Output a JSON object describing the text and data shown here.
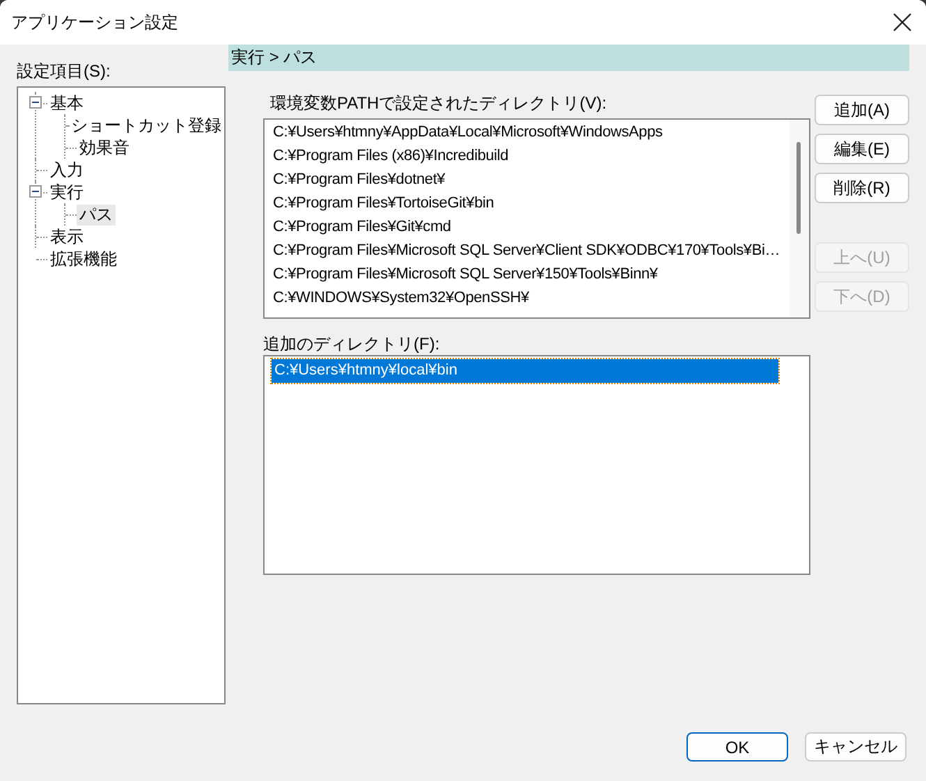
{
  "window": {
    "title": "アプリケーション設定"
  },
  "sidebar": {
    "label": "設定項目(S):",
    "items": [
      {
        "label": "基本",
        "expanded": true,
        "selected": false,
        "children": [
          {
            "label": "ショートカット登録",
            "selected": false
          },
          {
            "label": "効果音",
            "selected": false
          }
        ]
      },
      {
        "label": "入力",
        "selected": false
      },
      {
        "label": "実行",
        "expanded": true,
        "selected": false,
        "children": [
          {
            "label": "パス",
            "selected": true
          }
        ]
      },
      {
        "label": "表示",
        "selected": false
      },
      {
        "label": "拡張機能",
        "selected": false
      }
    ]
  },
  "breadcrumb": "実行 > パス",
  "path_list": {
    "label": "環境変数PATHで設定されたディレクトリ(V):",
    "items": [
      "C:¥Users¥htmny¥AppData¥Local¥Microsoft¥WindowsApps",
      "C:¥Program Files (x86)¥Incredibuild",
      "C:¥Program Files¥dotnet¥",
      "C:¥Program Files¥TortoiseGit¥bin",
      "C:¥Program Files¥Git¥cmd",
      "C:¥Program Files¥Microsoft SQL Server¥Client SDK¥ODBC¥170¥Tools¥Bi…",
      "C:¥Program Files¥Microsoft SQL Server¥150¥Tools¥Binn¥",
      "C:¥WINDOWS¥System32¥OpenSSH¥"
    ]
  },
  "extra_list": {
    "label": "追加のディレクトリ(F):",
    "items": [
      {
        "text": "C:¥Users¥htmny¥local¥bin",
        "selected": true
      }
    ]
  },
  "side_buttons": [
    {
      "label": "追加(A)",
      "disabled": false
    },
    {
      "label": "編集(E)",
      "disabled": false
    },
    {
      "label": "削除(R)",
      "disabled": false
    },
    {
      "label": "上へ(U)",
      "disabled": true
    },
    {
      "label": "下へ(D)",
      "disabled": true
    }
  ],
  "buttons": [
    {
      "label": "OK",
      "default": true
    },
    {
      "label": "キャンセル",
      "default": false
    }
  ]
}
